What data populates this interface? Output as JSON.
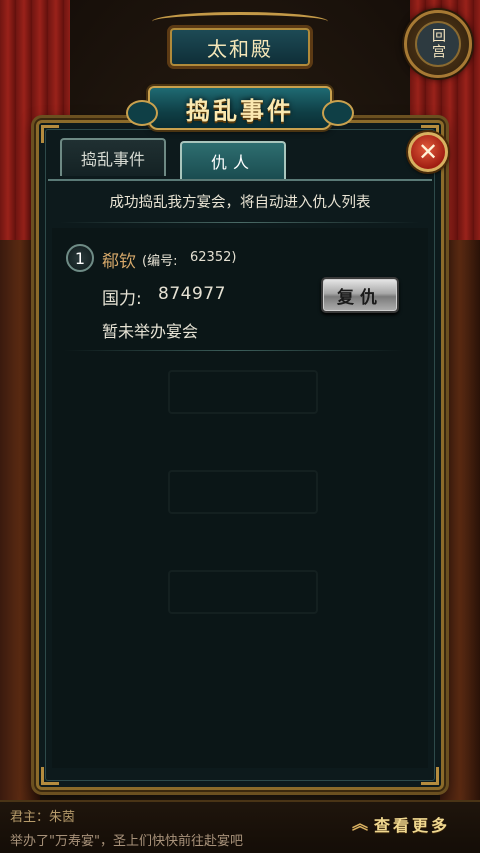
{
  "hall": {
    "title": "太和殿"
  },
  "return_button": {
    "label": "回宫"
  },
  "dialog": {
    "title": "捣乱事件",
    "tabs": [
      {
        "label": "捣乱事件",
        "active": false
      },
      {
        "label": "仇人",
        "active": true
      }
    ],
    "notice": "成功捣乱我方宴会，将自动进入仇人列表",
    "enemies": [
      {
        "rank": "1",
        "name": "郗钦",
        "id_label": "(编号:",
        "id_value": "62352)",
        "power_label": "国力:",
        "power_value": "874977",
        "banquet_status": "暂未举办宴会",
        "action_label": "复仇"
      }
    ],
    "close_icon": "close-icon"
  },
  "chat": {
    "line1": "君主：朱茵",
    "line2": "举办了\"万寿宴\"，圣上们快快前往赴宴吧",
    "more_label": "查看更多",
    "more_icon": "double-chevron-up-icon"
  },
  "colors": {
    "accent_gold": "#c9a14e",
    "panel_bg": "#0d1a1c",
    "enemy_name": "#d6a86a",
    "close_red": "#a01d12"
  }
}
